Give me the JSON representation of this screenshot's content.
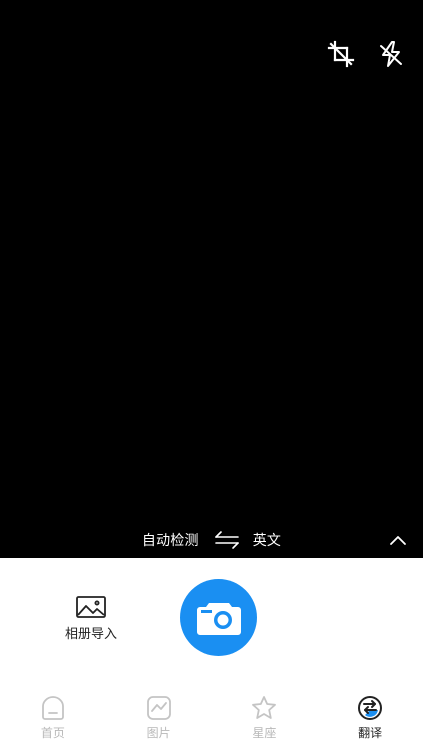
{
  "viewfinder": {
    "top_icons": [
      {
        "name": "crop-icon"
      },
      {
        "name": "flash-off-icon"
      }
    ]
  },
  "language_bar": {
    "source_language": "自动检测",
    "target_language": "英文"
  },
  "capture": {
    "album_import_label": "相册导入"
  },
  "bottom_nav": {
    "items": [
      {
        "label": "首页",
        "icon": "home-icon",
        "active": false
      },
      {
        "label": "图片",
        "icon": "image-trend-icon",
        "active": false
      },
      {
        "label": "星座",
        "icon": "star-icon",
        "active": false
      },
      {
        "label": "翻译",
        "icon": "translate-icon",
        "active": true
      }
    ]
  },
  "colors": {
    "accent": "#1a8ff2",
    "viewfinder_bg": "#000000",
    "nav_inactive": "#b8b8b8",
    "nav_active": "#222222"
  }
}
